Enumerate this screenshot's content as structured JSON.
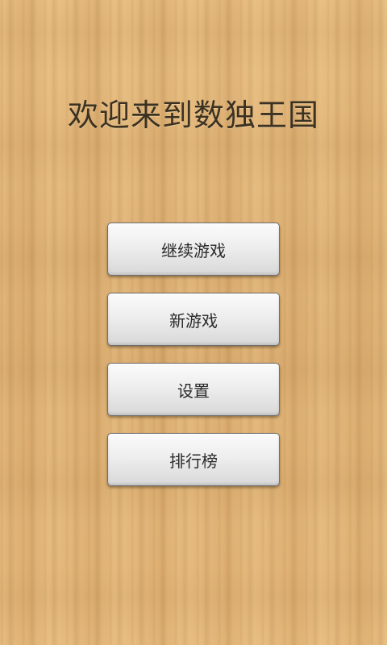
{
  "title": "欢迎来到数独王国",
  "menu": {
    "continue_label": "继续游戏",
    "new_game_label": "新游戏",
    "settings_label": "设置",
    "leaderboard_label": "排行榜"
  },
  "colors": {
    "background": "#e2b577",
    "title_text": "#3c3222",
    "button_text": "#2a2a2a"
  }
}
